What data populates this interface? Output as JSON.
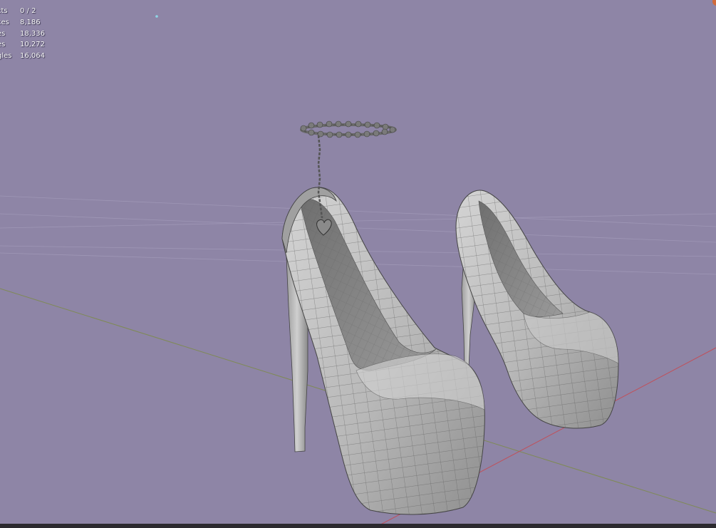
{
  "stats": [
    {
      "label": "Objects",
      "display": "cts",
      "value": "0 / 2"
    },
    {
      "label": "Vertices",
      "display": "ces",
      "value": "8,186"
    },
    {
      "label": "Edges",
      "display": "es",
      "value": "18,336"
    },
    {
      "label": "Faces",
      "display": "es",
      "value": "10,272"
    },
    {
      "label": "Triangles",
      "display": "gles",
      "value": "16,064"
    }
  ],
  "colors": {
    "background": "#8e85a6",
    "mesh_fill": "#b5b5b5",
    "wire": "#5e5e5e",
    "x_axis": "#c0505a",
    "y_axis": "#7f8a55"
  }
}
